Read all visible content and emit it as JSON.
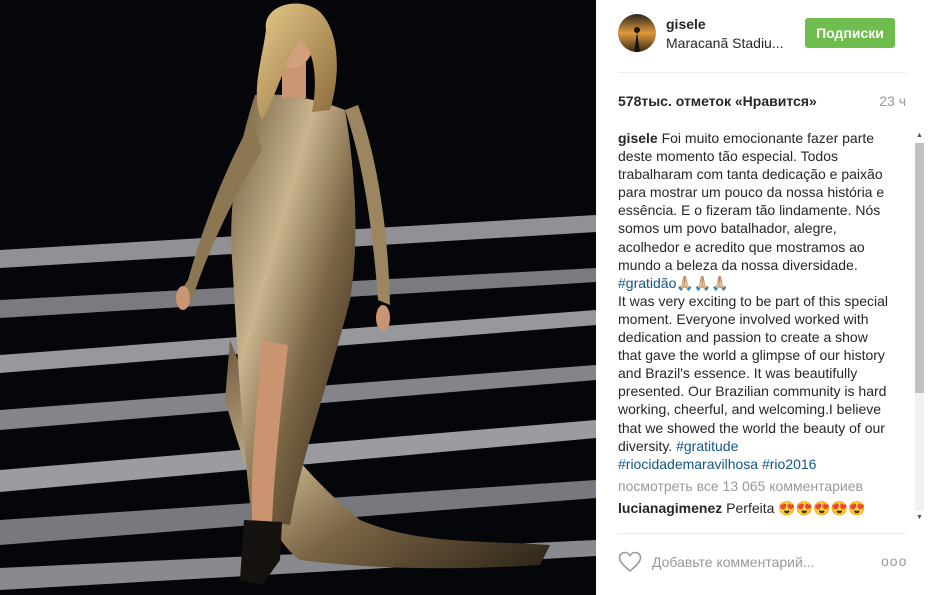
{
  "post": {
    "username": "gisele",
    "location": "Maracanã Stadiu...",
    "follow_label": "Подписки",
    "likes": "578тыс. отметок «Нравится»",
    "time": "23 ч",
    "caption_user": "gisele",
    "caption_pt": "Foi muito emocionante fazer parte deste momento tão especial. Todos trabalharam com tanta dedicação e paixão para mostrar um pouco da nossa história e essência. E o fizeram tão lindamente. Nós somos um povo batalhador, alegre, acolhedor e acredito que mostramos ao mundo a beleza da nossa diversidade.",
    "tag_gratidao": "#gratidão",
    "emoji": "🙏🏼🙏🏼🙏🏼",
    "caption_en": "It was very exciting to be part of this special moment. Everyone involved worked with dedication and passion to create a show that gave the world a glimpse of our history and Brazil's essence. It was beautifully presented. Our Brazilian community is hard working, cheerful, and welcoming.I believe that we showed the world the beauty of our diversity.",
    "tag_gratitude": "#gratitude",
    "tag_riocidade": "#riocidademaravilhosa",
    "tag_rio2016": "#rio2016",
    "view_all": "посмотреть все 13 065 комментариев",
    "next_comment_user": "lucianagimenez",
    "next_comment_text": "Perfeita 😍😍😍😍😍",
    "add_comment_placeholder": "Добавьте комментарий...",
    "more_label": "ooo"
  },
  "icons": {
    "heart": "heart-outline-icon",
    "more": "more-dots-icon",
    "scroll_up": "scroll-up-arrow-icon",
    "scroll_down": "scroll-down-arrow-icon"
  },
  "colors": {
    "follow_bg": "#6fbc4f",
    "hashtag": "#125688",
    "muted": "#999999"
  }
}
